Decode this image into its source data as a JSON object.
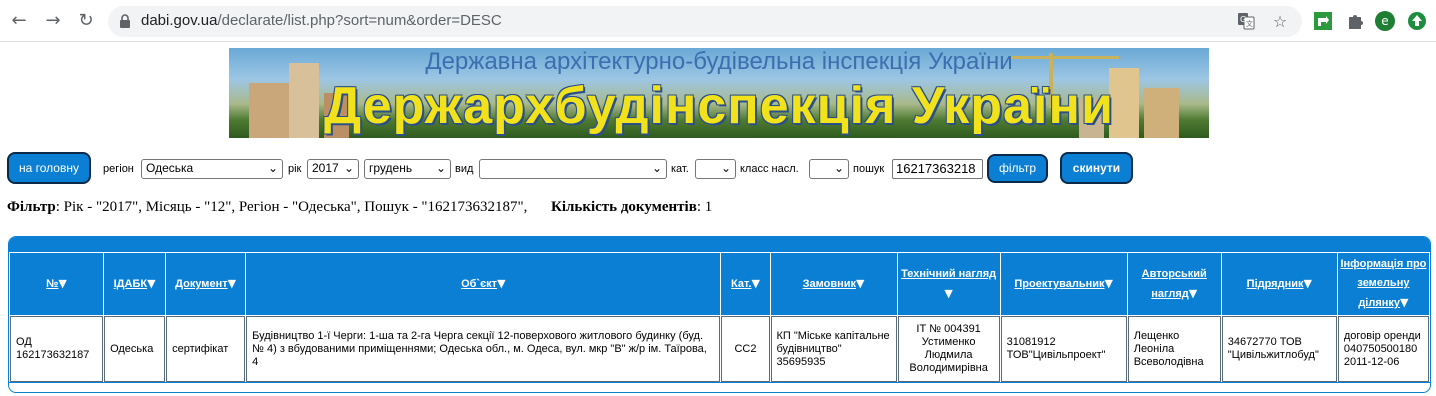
{
  "browser": {
    "url_host": "dabi.gov.ua",
    "url_path": "/declarate/list.php?sort=num&order=DESC",
    "profile_initial": "e"
  },
  "banner": {
    "subtitle": "Державна архітектурно-будівельна інспекція України",
    "title": "Держархбудінспекція України"
  },
  "filters": {
    "home_button": "на головну",
    "region_label": "регіон",
    "region_value": "Одеська",
    "year_label": "рік",
    "year_value": "2017",
    "month_value": "грудень",
    "type_label": "вид",
    "type_value": "",
    "cat_label": "кат.",
    "cat_value": "",
    "class_label": "класс насл.",
    "class_value": "",
    "search_label": "пошук",
    "search_value": "16217363218",
    "filter_button": "фільтр",
    "reset_button": "скинути"
  },
  "summary": {
    "filter_label": "Фільтр",
    "filter_text": ": Рік - \"2017\", Місяць - \"12\", Регіон - \"Одеська\", Пошук - \"162173632187\",",
    "count_label": "Кількість документів",
    "count_value": ": 1"
  },
  "table": {
    "columns": [
      "№",
      "ІДАБК",
      "Документ",
      "Об`єкт",
      "Кат.",
      "Замовник",
      "Технічний нагляд",
      "Проектувальник",
      "Авторський нагляд",
      "Підрядник",
      "Інформація про земельну ділянку"
    ],
    "rows": [
      [
        "ОД 162173632187",
        "Одеська",
        "сертифікат",
        "Будівництво 1-ї Черги: 1-ша та 2-га Черга секції 12-поверхового житлового будинку (буд. № 4) з вбудованими приміщеннями; Одеська обл., м. Одеса, вул. мкр \"В\" ж/р ім. Таїрова, 4",
        "СС2",
        "КП \"Міське капітальне будівництво\" 35695935",
        "ІТ № 004391 Устименко Людмила Володимирівна",
        "31081912 ТОВ\"Цивільпроект\"",
        "Лещенко Леоніла Всеволодівна",
        "34672770 ТОВ \"Цивільжитлобуд\"",
        "договір оренди 040750500180 2011-12-06"
      ]
    ]
  },
  "colors": {
    "accent": "#0b7fd4",
    "button_border": "#0a2a4a"
  }
}
